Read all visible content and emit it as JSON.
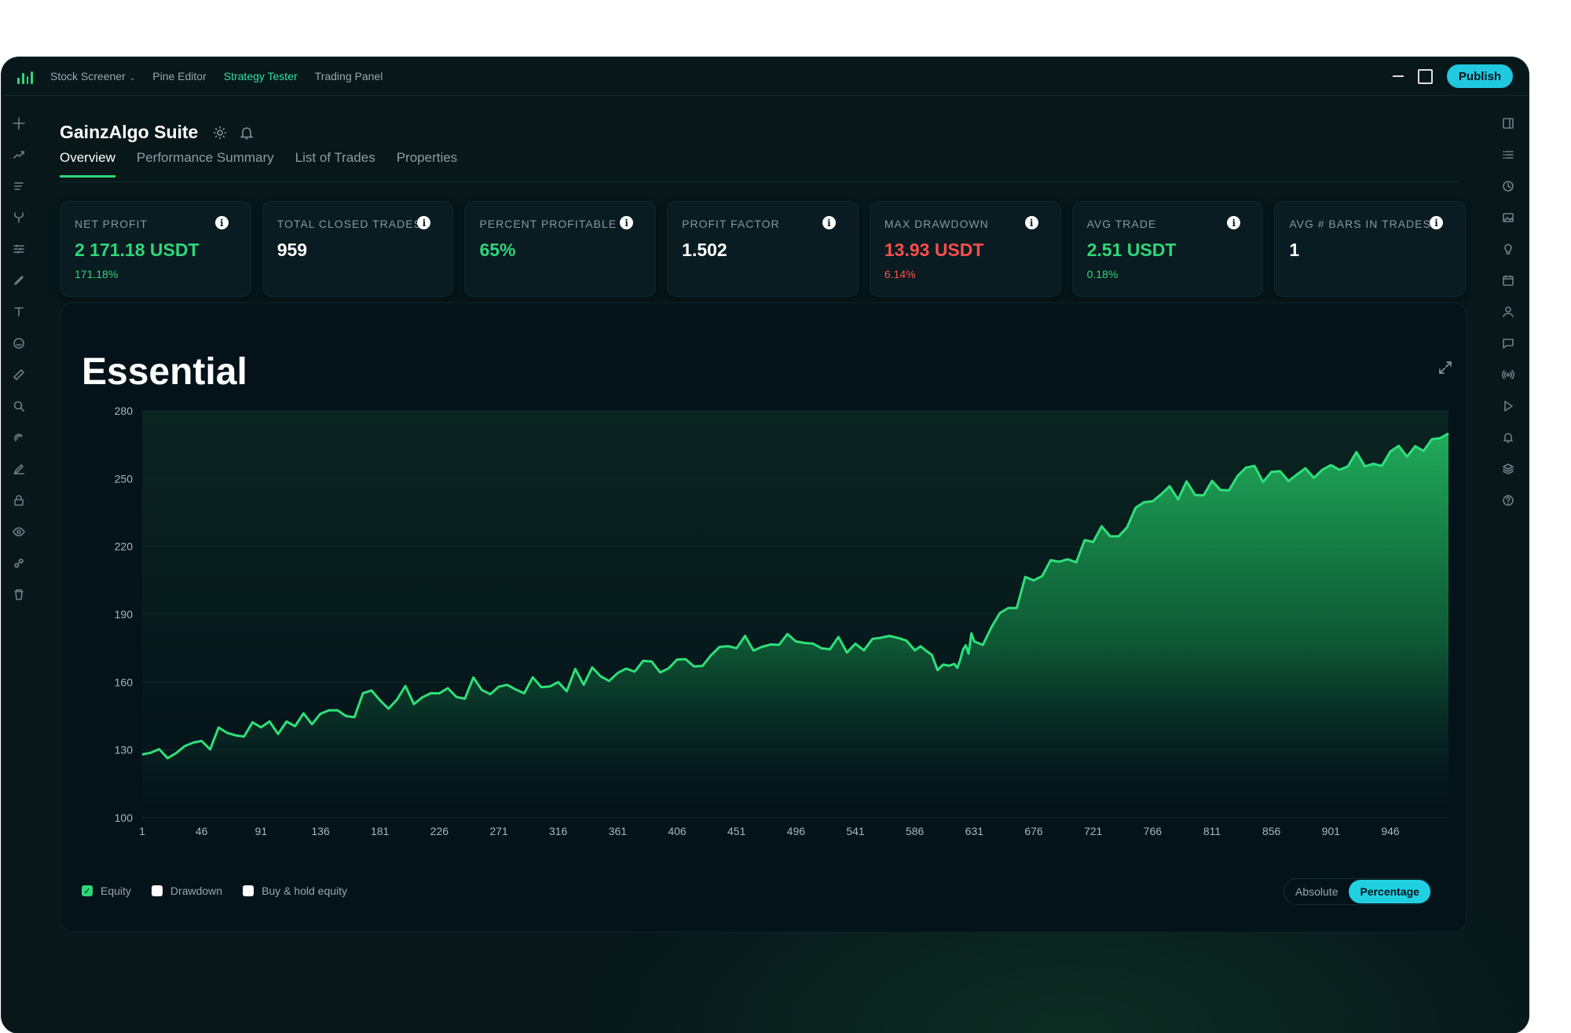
{
  "nav": {
    "items": [
      {
        "label": "Stock Screener",
        "has_caret": true,
        "active": false
      },
      {
        "label": "Pine Editor",
        "active": false
      },
      {
        "label": "Strategy Tester",
        "active": true
      },
      {
        "label": "Trading Panel",
        "active": false
      }
    ],
    "publish_label": "Publish"
  },
  "header": {
    "title": "GainzAlgo Suite",
    "tabs": [
      {
        "label": "Overview",
        "active": true
      },
      {
        "label": "Performance Summary",
        "active": false
      },
      {
        "label": "List of Trades",
        "active": false
      },
      {
        "label": "Properties",
        "active": false
      }
    ]
  },
  "stats": [
    {
      "label": "NET PROFIT",
      "value": "2 171.18 USDT",
      "sub": "171.18%",
      "tone": "green"
    },
    {
      "label": "TOTAL CLOSED TRADES",
      "value": "959",
      "sub": "",
      "tone": "white"
    },
    {
      "label": "PERCENT PROFITABLE",
      "value": "65%",
      "sub": "",
      "tone": "green"
    },
    {
      "label": "PROFIT FACTOR",
      "value": "1.502",
      "sub": "",
      "tone": "white"
    },
    {
      "label": "MAX DRAWDOWN",
      "value": "13.93 USDT",
      "sub": "6.14%",
      "tone": "red"
    },
    {
      "label": "AVG TRADE",
      "value": "2.51 USDT",
      "sub": "0.18%",
      "tone": "green"
    },
    {
      "label": "AVG # BARS IN TRADES",
      "value": "1",
      "sub": "",
      "tone": "white"
    }
  ],
  "panel": {
    "title": "Essential",
    "legend": [
      {
        "label": "Equity",
        "checked": true
      },
      {
        "label": "Drawdown",
        "checked": false
      },
      {
        "label": "Buy & hold equity",
        "checked": false
      }
    ],
    "toggle": [
      {
        "label": "Absolute",
        "selected": false
      },
      {
        "label": "Percentage",
        "selected": true
      }
    ]
  },
  "colors": {
    "accent": "#2fd67a",
    "negative": "#ff4d4d",
    "cyan": "#20c8e0"
  },
  "chart_data": {
    "type": "area",
    "title": "",
    "xlabel": "",
    "ylabel": "",
    "x_ticks": [
      1,
      46,
      91,
      136,
      181,
      226,
      271,
      316,
      361,
      406,
      451,
      496,
      541,
      586,
      631,
      676,
      721,
      766,
      811,
      856,
      901,
      946
    ],
    "y_ticks": [
      100,
      130,
      160,
      190,
      220,
      250,
      280
    ],
    "xlim": [
      1,
      990
    ],
    "ylim": [
      100,
      280
    ],
    "series": [
      {
        "name": "Equity",
        "x": [
          1,
          46,
          91,
          136,
          181,
          226,
          271,
          316,
          361,
          406,
          451,
          496,
          541,
          586,
          616,
          631,
          676,
          721,
          766,
          811,
          856,
          901,
          946,
          990
        ],
        "values": [
          128,
          134,
          140,
          146,
          152,
          155,
          158,
          160,
          164,
          170,
          175,
          178,
          177,
          174,
          168,
          178,
          205,
          222,
          240,
          249,
          253,
          256,
          262,
          270
        ]
      }
    ],
    "grid": true
  }
}
